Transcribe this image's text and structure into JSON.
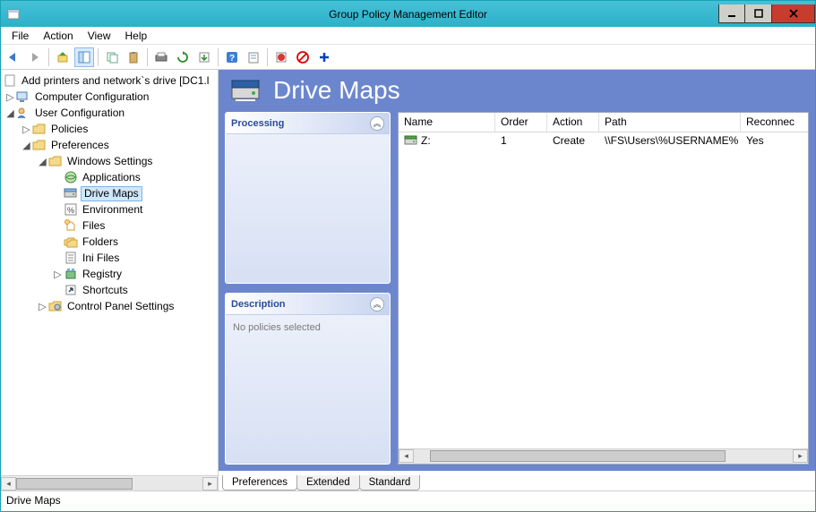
{
  "window": {
    "title": "Group Policy Management Editor"
  },
  "menu": {
    "file": "File",
    "action": "Action",
    "view": "View",
    "help": "Help"
  },
  "tree": {
    "root": "Add printers and network`s drive [DC1.l",
    "computer_config": "Computer Configuration",
    "user_config": "User Configuration",
    "policies": "Policies",
    "preferences": "Preferences",
    "windows_settings": "Windows Settings",
    "applications": "Applications",
    "drive_maps": "Drive Maps",
    "environment": "Environment",
    "files": "Files",
    "folders": "Folders",
    "ini_files": "Ini Files",
    "registry": "Registry",
    "shortcuts": "Shortcuts",
    "control_panel": "Control Panel Settings"
  },
  "preview": {
    "title": "Drive Maps",
    "panels": {
      "processing": "Processing",
      "description_title": "Description",
      "description_body": "No policies selected"
    }
  },
  "list": {
    "headers": {
      "name": "Name",
      "order": "Order",
      "action": "Action",
      "path": "Path",
      "reconnect": "Reconnec"
    },
    "rows": [
      {
        "name": "Z:",
        "order": "1",
        "action": "Create",
        "path": "\\\\FS\\Users\\%USERNAME%",
        "reconnect": "Yes"
      }
    ]
  },
  "tabs": {
    "preferences": "Preferences",
    "extended": "Extended",
    "standard": "Standard"
  },
  "statusbar": "Drive Maps"
}
